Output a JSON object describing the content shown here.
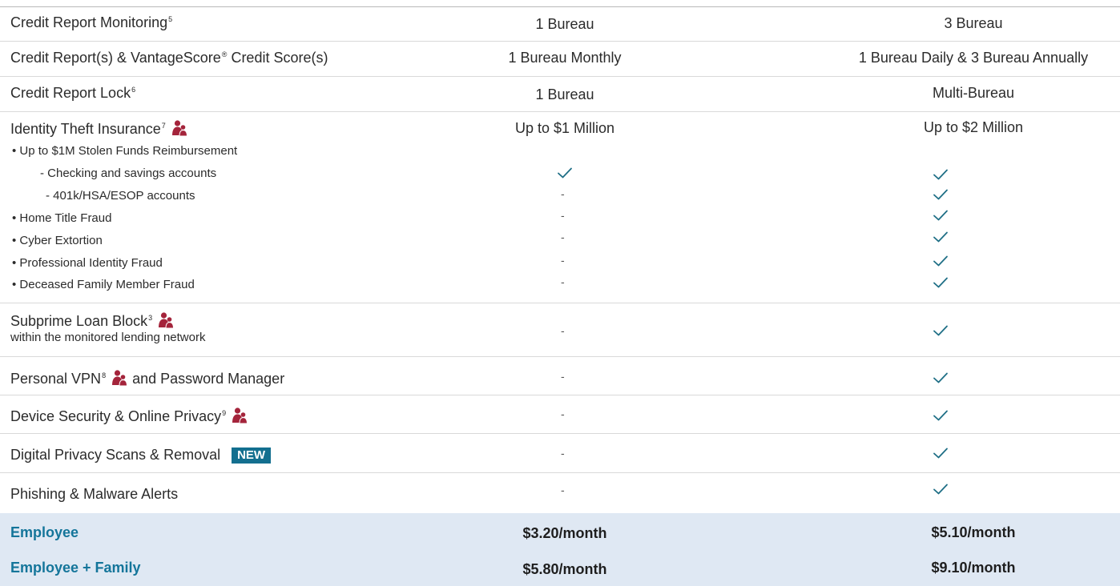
{
  "rows": [
    {
      "label": "Credit Report Monitoring",
      "sup": "5",
      "col1": "1 Bureau",
      "col2": "3 Bureau"
    },
    {
      "label": "Credit Report(s)  & VantageScore",
      "reg": "®",
      "label_tail": " Credit Score(s)",
      "col1": "1 Bureau Monthly",
      "col2": "1 Bureau Daily & 3 Bureau Annually"
    },
    {
      "label": "Credit Report Lock",
      "sup": "6",
      "col1": "1 Bureau",
      "col2": "Multi-Bureau"
    },
    {
      "label": "Identity Theft Insurance",
      "sup": "7",
      "col1": "Up to $1 Million",
      "col2": "Up to $2 Million"
    }
  ],
  "insurance_items": [
    {
      "label": "• Up to $1M Stolen Funds Reimbursement"
    },
    {
      "label": "- Checking and savings accounts",
      "col1": "check",
      "col2": "check"
    },
    {
      "label": "- 401k/HSA/ESOP accounts",
      "col1": "-",
      "col2": "check"
    },
    {
      "label": "• Home Title Fraud",
      "col1": "-",
      "col2": "check"
    },
    {
      "label": "• Cyber Extortion",
      "col1": "-",
      "col2": "check"
    },
    {
      "label": "• Professional Identity Fraud",
      "col1": "-",
      "col2": "check"
    },
    {
      "label": "• Deceased Family Member Fraud",
      "col1": "-",
      "col2": "check"
    }
  ],
  "features": [
    {
      "label": "Subprime Loan Block",
      "sup": "3",
      "sublabel": "within the monitored lending network",
      "col1": "-",
      "col2": "check"
    },
    {
      "label": "Personal VPN",
      "sup": "8",
      "label_tail": " and Password Manager",
      "col1": "-",
      "col2": "check"
    },
    {
      "label": "Device Security & Online Privacy",
      "sup": "9",
      "col1": "-",
      "col2": "check"
    },
    {
      "label": "Digital Privacy Scans & Removal",
      "badge": "NEW",
      "col1": "-",
      "col2": "check"
    },
    {
      "label": "Phishing & Malware Alerts",
      "col1": "-",
      "col2": "check"
    }
  ],
  "pricing": [
    {
      "label": "Employee",
      "col1": "$3.20/month",
      "col2": "$5.10/month"
    },
    {
      "label": "Employee + Family",
      "col1": "$5.80/month",
      "col2": "$9.10/month"
    }
  ],
  "colors": {
    "accent": "#14759a",
    "check": "#1f6f86",
    "family_icon": "#a4243b",
    "band": "#dfe8f3"
  },
  "icons": {
    "check": "check-icon",
    "family": "family-member-icon"
  }
}
